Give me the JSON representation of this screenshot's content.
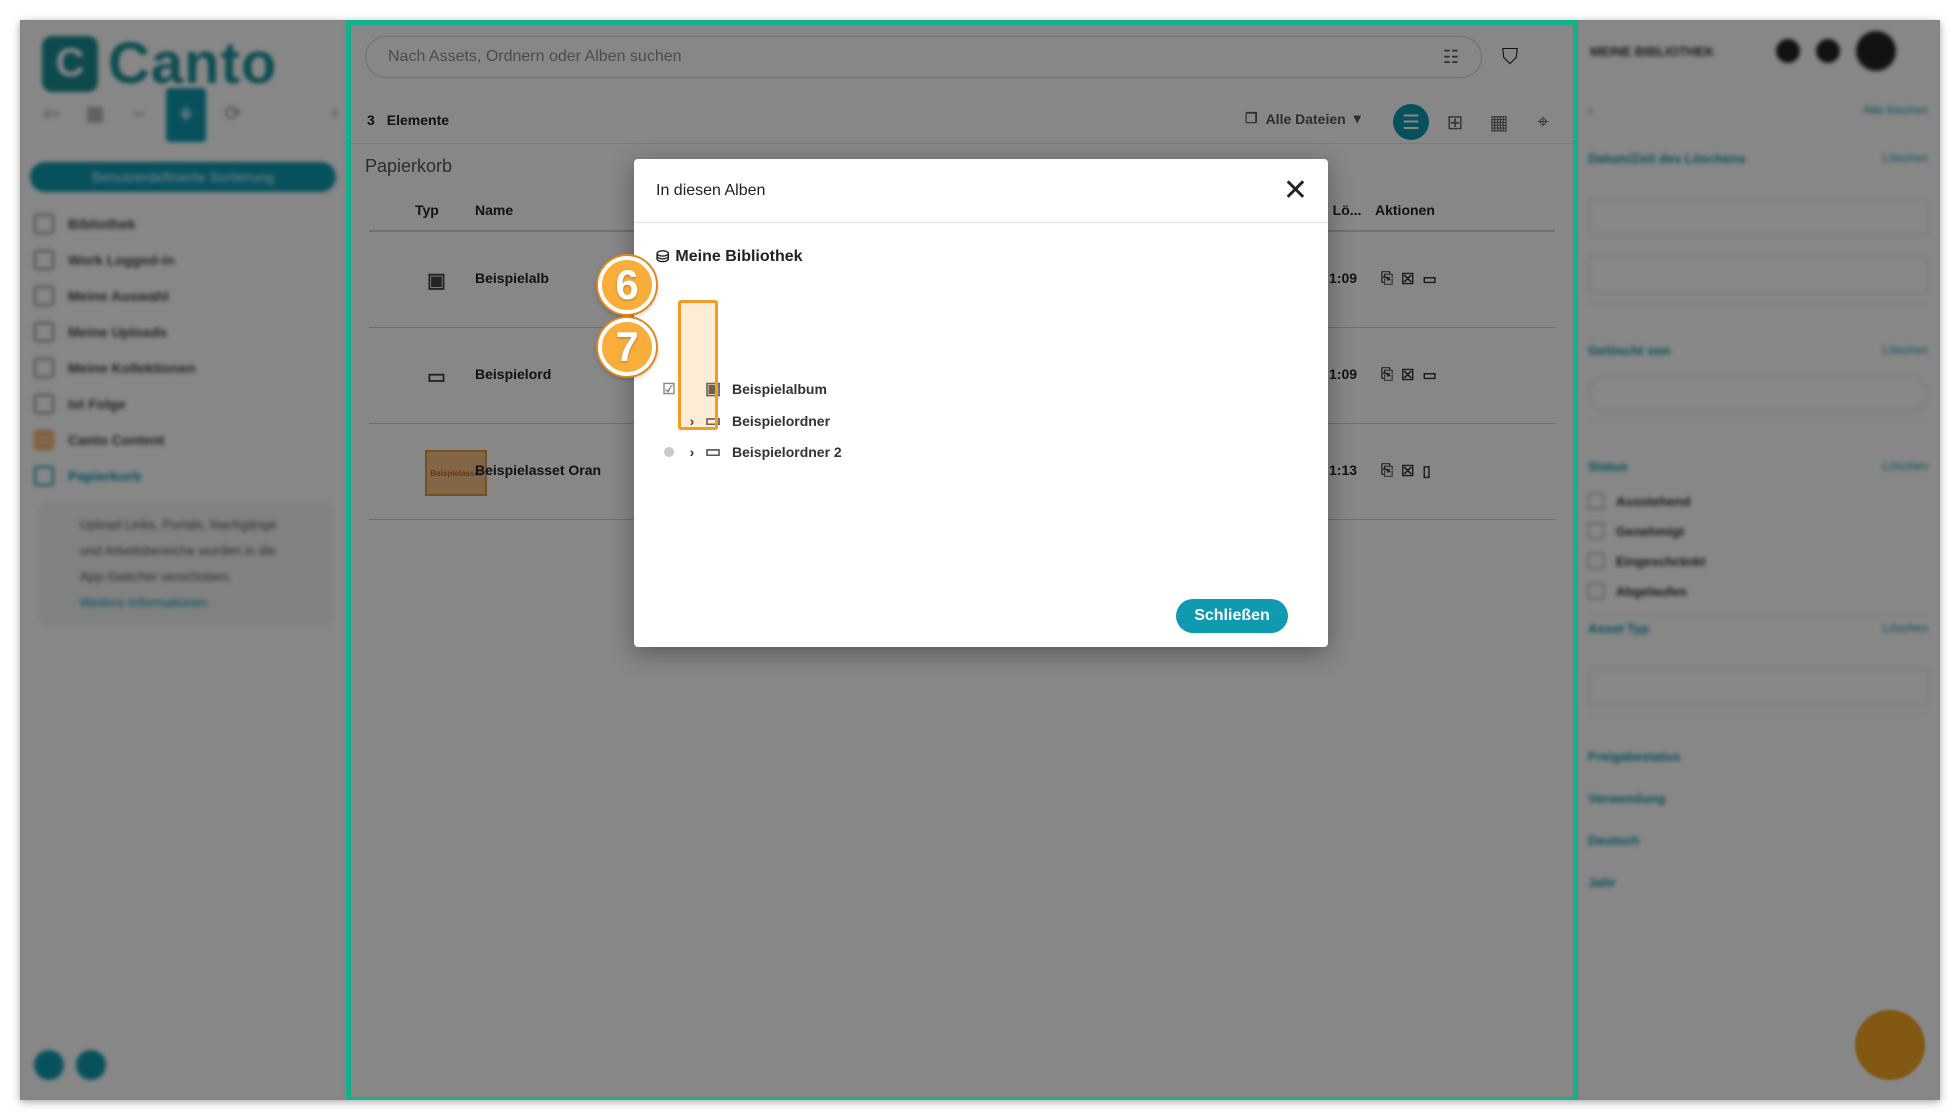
{
  "app": {
    "logo_text": "Canto",
    "logo_mark": "C"
  },
  "sidebar": {
    "primary_button": "Benutzerdefinierte Sortierung",
    "items": [
      {
        "label": "Bibliothek",
        "icon": "library-icon"
      },
      {
        "label": "Work Logged-in",
        "icon": "grid-icon"
      },
      {
        "label": "Meine Auswahl",
        "icon": "selection-icon"
      },
      {
        "label": "Meine Uploads",
        "icon": "upload-icon"
      },
      {
        "label": "Meine Kollektionen",
        "icon": "collection-icon"
      },
      {
        "label": "Ist Folge",
        "icon": "follow-icon"
      },
      {
        "label": "Canto Content",
        "icon": "content-icon"
      },
      {
        "label": "Papierkorb",
        "icon": "trash-icon"
      }
    ],
    "note": {
      "line1": "Upload Links, Portals, Nachgänge",
      "line2": "und Arbeitsbereiche wurden in die",
      "line3": "App-Switcher verschoben.",
      "link": "Weitere Informationen"
    }
  },
  "header": {
    "search_placeholder": "Nach Assets, Ordnern oder Alben suchen",
    "library_label": "MEINE BIBLIOTHEK"
  },
  "toolbar": {
    "count": "3",
    "count_label": "Elemente",
    "filter_label": "Alle Dateien"
  },
  "breadcrumb": "Papierkorb",
  "table": {
    "columns": {
      "type": "Typ",
      "name": "Name",
      "deleted": "s Lö...",
      "actions": "Aktionen"
    },
    "rows": [
      {
        "name": "Beispielalb",
        "time": "1:09",
        "type_icon": "album-icon"
      },
      {
        "name": "Beispielord",
        "time": "1:09",
        "type_icon": "folder-icon"
      },
      {
        "name": "Beispielasset Oran",
        "time": "1:13",
        "type_icon": "thumbnail",
        "thumb_text": "Beispielasset"
      }
    ]
  },
  "right_panel": {
    "sections": [
      {
        "title": "Datum/Zeit des Löschens",
        "action": "Löschen"
      },
      {
        "title": "Gelöscht von",
        "action": "Löschen"
      },
      {
        "title": "Status",
        "action": "Löschen"
      },
      {
        "title": "Asset Typ",
        "action": "Löschen"
      },
      {
        "title": "Freigabestatus",
        "action": ""
      },
      {
        "title": "Verwendung",
        "action": ""
      },
      {
        "title": "Deutsch",
        "action": ""
      },
      {
        "title": "Jahr",
        "action": ""
      }
    ],
    "status_options": [
      "Ausstehend",
      "Genehmigt",
      "Eingeschränkt",
      "Abgelaufen"
    ],
    "top_link": "Alle löschen"
  },
  "modal": {
    "title": "In diesen Alben",
    "library": "Meine Bibliothek",
    "tree": [
      {
        "label": "Beispielalbum",
        "state": "checked",
        "icon": "album-icon",
        "expandable": false
      },
      {
        "label": "Beispielordner",
        "state": "none",
        "icon": "folder-icon",
        "expandable": true
      },
      {
        "label": "Beispielordner 2",
        "state": "partial",
        "icon": "folder-icon",
        "expandable": true
      }
    ],
    "close_button": "Schließen"
  },
  "callouts": [
    "6",
    "7"
  ],
  "colors": {
    "accent": "#0f9ab0",
    "callout": "#f9ad3a",
    "frame": "#12b08d"
  }
}
